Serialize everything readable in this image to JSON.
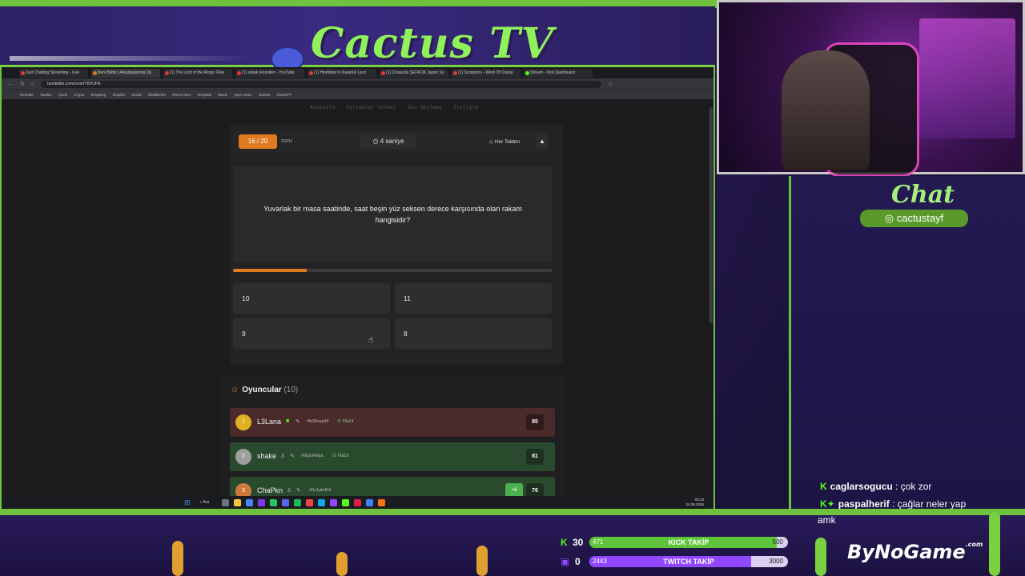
{
  "overlay": {
    "brand_title": "Cactus TV",
    "chat_title": "Chat",
    "chat_handle": "cactustayf",
    "sponsor": "ByNoGame",
    "sponsor_suffix": ".com"
  },
  "browser": {
    "tabs": [
      {
        "label": "Just Chatting Streaming - Live"
      },
      {
        "label": "Beni Bildin | Arkadaşlarınla Oy"
      },
      {
        "label": "(1) The Lord of the Rings: Rise"
      },
      {
        "label": "(1) sokak lezzetleri - YouTube"
      },
      {
        "label": "(1) Hindistan'ın Karanlık Lezz"
      },
      {
        "label": "(1) Ocaka'da ŞEFKOK Japon So"
      },
      {
        "label": "(1) Scorpions - Wind Of Chang"
      },
      {
        "label": "Stream - Kick Dashboard"
      }
    ],
    "url": "benibildin.com/room/YBVUFN",
    "bookmarks": [
      "YouTube",
      "Yandex",
      "Çeviri",
      "Crypto",
      "Shopping",
      "Graphic",
      "Social",
      "İzlediklerim",
      "Plat İs Sam",
      "Template",
      "Music",
      "yayın video",
      "Games",
      "ChatGPT"
    ]
  },
  "site": {
    "nav": [
      "Anasayfa",
      "Kelimeler Vetmez",
      "Onu Söyleme",
      "İletişim"
    ],
    "question_counter": "16 / 20",
    "question_counter_label": "soru",
    "timer_value": "4",
    "timer_unit": "saniye",
    "category": "Her Telden",
    "report_icon": "warning-icon",
    "question": "Yuvarlak bir masa saatinde, saat beşin yüz seksen derece karşısında olan rakam hangisidir?",
    "time_progress": 0.23,
    "answers": [
      "10",
      "11",
      "9",
      "8"
    ],
    "players_title": "Oyuncular",
    "players_count": "(10)",
    "players": [
      {
        "rank": "1",
        "name": "L3Lana",
        "id": "#b08eaad9",
        "status": "Hazır",
        "score": "85",
        "bonus": "",
        "color": "#e0b020",
        "row_bg": "#4a2a2a"
      },
      {
        "rank": "2",
        "name": "shake",
        "id": "#9a2d4eba",
        "status": "Hazır",
        "score": "81",
        "bonus": "",
        "color": "#9e9e9e",
        "row_bg": "#2a4a2e"
      },
      {
        "rank": "3",
        "name": "ChaPkn",
        "id": "#0c1abd64",
        "status": "",
        "score": "76",
        "bonus": "+6",
        "color": "#d07a3a",
        "row_bg": "#2a4a2e"
      }
    ]
  },
  "taskbar": {
    "search": "Ara",
    "time": "00:23",
    "date": "24.06.2025"
  },
  "chat": {
    "messages": [
      {
        "user": "caglarsogucu",
        "text": " : çok zor"
      },
      {
        "user": "paspalherif",
        "text": " : çağlar neler yap",
        "continuation": "amk"
      }
    ]
  },
  "goals": {
    "kick": {
      "count": "30",
      "current": "471",
      "label": "KICK TAKİP",
      "target": "500",
      "progress": 0.942,
      "color": "#5fc43a"
    },
    "twitch": {
      "count": "0",
      "current": "2443",
      "label": "TWITCH TAKİP",
      "target": "3000",
      "progress": 0.814,
      "color": "#9146ff"
    }
  }
}
